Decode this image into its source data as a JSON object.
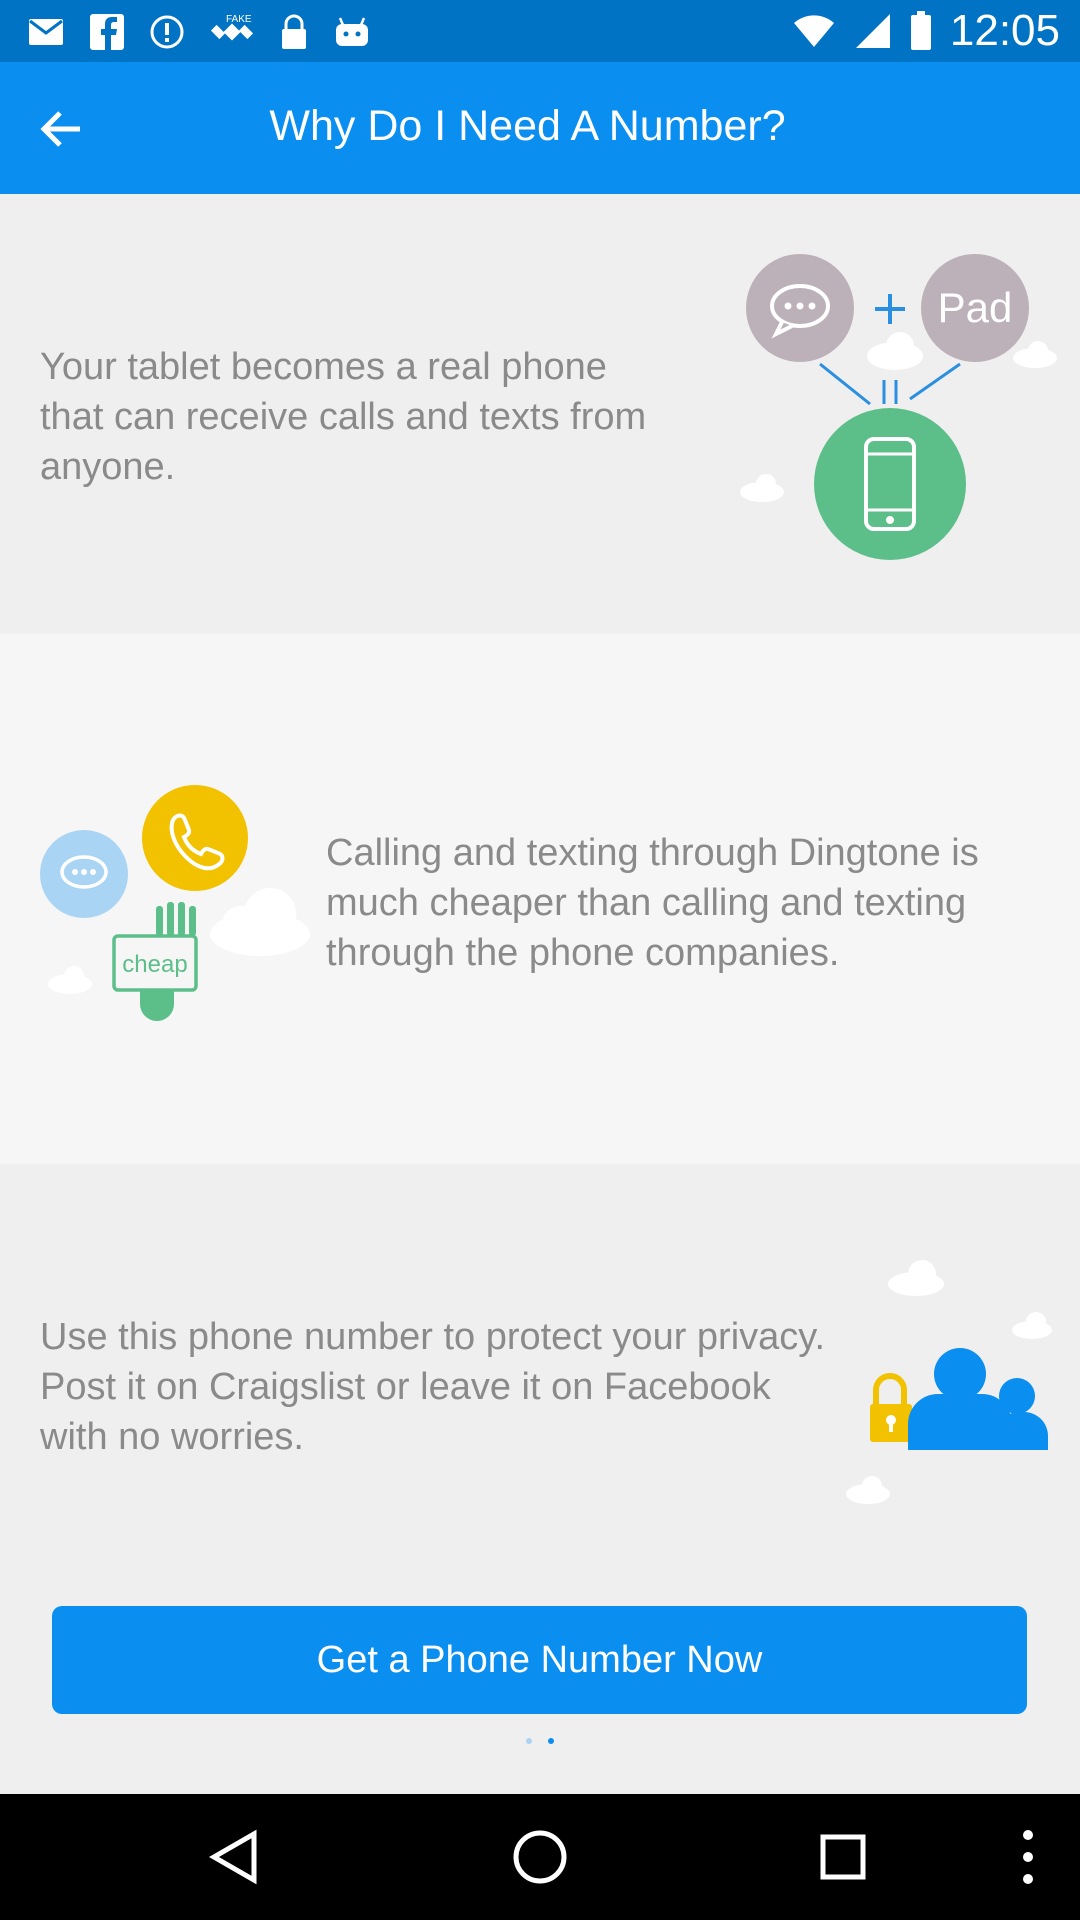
{
  "status_bar": {
    "time": "12:05",
    "left_icons": [
      "mail-icon",
      "facebook-icon",
      "alert-icon",
      "fake-gps-icon",
      "lock-icon",
      "android-icon"
    ],
    "right_icons": [
      "wifi-icon",
      "signal-icon",
      "battery-icon"
    ]
  },
  "app_bar": {
    "title": "Why Do I Need A Number?",
    "back_icon": "arrow-left-icon"
  },
  "sections": [
    {
      "text": "Your tablet becomes a real phone that can receive calls and texts from anyone.",
      "illustration": "chat-plus-pad-to-phone",
      "illustration_label": "Pad"
    },
    {
      "text": "Calling and texting through Dingtone is much cheaper than calling and texting through the phone companies.",
      "illustration": "chat-phone-cheap-plug",
      "illustration_label": "cheap"
    },
    {
      "text": "Use this phone number to protect your privacy. Post it on Craigslist or leave it on Facebook with no worries.",
      "illustration": "lock-and-people"
    }
  ],
  "cta": {
    "label": "Get a Phone Number Now"
  },
  "pager": {
    "count": 2,
    "active": 1
  },
  "nav_bar": {
    "buttons": [
      "back-icon",
      "home-icon",
      "recents-icon",
      "more-icon"
    ]
  },
  "colors": {
    "primary": "#0a8ef0",
    "status": "#0073c4",
    "green": "#5cbf8a",
    "yellow": "#f2c200",
    "gray": "#bcb1b8",
    "lightblue": "#a9d4f4"
  }
}
